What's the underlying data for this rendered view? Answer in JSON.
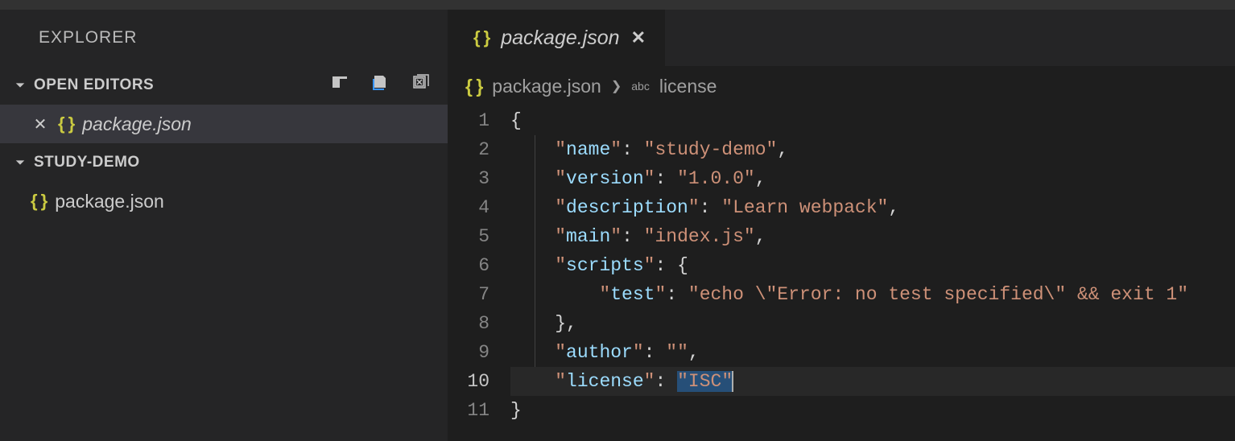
{
  "sidebar": {
    "title": "EXPLORER",
    "openEditors": {
      "label": "OPEN EDITORS",
      "items": [
        {
          "name": "package.json"
        }
      ]
    },
    "workspace": {
      "label": "STUDY-DEMO",
      "files": [
        {
          "name": "package.json"
        }
      ]
    }
  },
  "tab": {
    "filename": "package.json"
  },
  "breadcrumb": {
    "file": "package.json",
    "symbol": "license",
    "symbolKind": "abc"
  },
  "code": {
    "lines": [
      {
        "n": "1",
        "indent": 0,
        "type": "brace",
        "text": "{"
      },
      {
        "n": "2",
        "indent": 1,
        "type": "kv",
        "key": "name",
        "value": "study-demo",
        "comma": true
      },
      {
        "n": "3",
        "indent": 1,
        "type": "kv",
        "key": "version",
        "value": "1.0.0",
        "comma": true
      },
      {
        "n": "4",
        "indent": 1,
        "type": "kv",
        "key": "description",
        "value": "Learn webpack",
        "comma": true
      },
      {
        "n": "5",
        "indent": 1,
        "type": "kv",
        "key": "main",
        "value": "index.js",
        "comma": true
      },
      {
        "n": "6",
        "indent": 1,
        "type": "kobj",
        "key": "scripts"
      },
      {
        "n": "7",
        "indent": 2,
        "type": "kv",
        "key": "test",
        "value": "echo \\\"Error: no test specified\\\" && exit 1",
        "comma": false
      },
      {
        "n": "8",
        "indent": 1,
        "type": "closebrace",
        "comma": true
      },
      {
        "n": "9",
        "indent": 1,
        "type": "kv",
        "key": "author",
        "value": "",
        "comma": true
      },
      {
        "n": "10",
        "indent": 1,
        "type": "kv",
        "key": "license",
        "value": "ISC",
        "comma": false,
        "active": true,
        "selected": true,
        "cursor": true
      },
      {
        "n": "11",
        "indent": 0,
        "type": "brace",
        "text": "}"
      }
    ]
  }
}
